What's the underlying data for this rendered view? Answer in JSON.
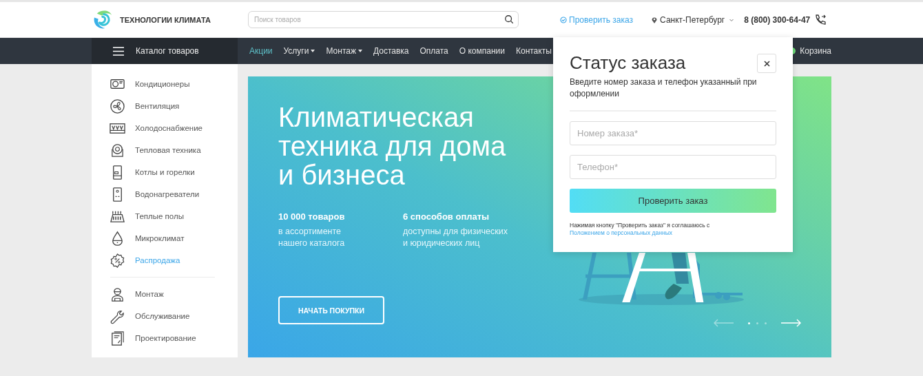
{
  "header": {
    "logo_text": "ТЕХНОЛОГИИ КЛИМАТА",
    "search": {
      "placeholder": "Поиск товаров"
    },
    "check_order": "Проверить заказ",
    "city": "Санкт-Петербург",
    "phone": "8 (800) 300-64-47"
  },
  "nav": {
    "catalog": "Каталог товаров",
    "items": [
      {
        "label": "Акции",
        "selected": true,
        "dropdown": false
      },
      {
        "label": "Услуги",
        "selected": false,
        "dropdown": true
      },
      {
        "label": "Монтаж",
        "selected": false,
        "dropdown": true
      },
      {
        "label": "Доставка",
        "selected": false,
        "dropdown": false
      },
      {
        "label": "Оплата",
        "selected": false,
        "dropdown": false
      },
      {
        "label": "О компании",
        "selected": false,
        "dropdown": false
      },
      {
        "label": "Контакты",
        "selected": false,
        "dropdown": false
      }
    ],
    "cart": "Корзина"
  },
  "sidebar": {
    "groups": [
      {
        "items": [
          {
            "label": "Кондиционеры",
            "selected": false
          },
          {
            "label": "Вентиляция",
            "selected": false
          },
          {
            "label": "Холодоснабжение",
            "selected": false
          },
          {
            "label": "Тепловая техника",
            "selected": false
          },
          {
            "label": "Котлы и горелки",
            "selected": false
          },
          {
            "label": "Водонагреватели",
            "selected": false
          },
          {
            "label": "Теплые полы",
            "selected": false
          },
          {
            "label": "Микроклимат",
            "selected": false
          },
          {
            "label": "Распродажа",
            "selected": true
          }
        ]
      },
      {
        "items": [
          {
            "label": "Монтаж",
            "selected": false
          },
          {
            "label": "Обслуживание",
            "selected": false
          },
          {
            "label": "Проектирование",
            "selected": false
          }
        ]
      }
    ]
  },
  "banner": {
    "title": "Климатическая техника для дома и бизнеса",
    "stats": [
      {
        "value": "10 000 товаров",
        "caption": "в ассортименте нашего каталога"
      },
      {
        "value": "6 способов оплаты",
        "caption": "доступны для физических и юридических лиц"
      }
    ],
    "button": "НАЧАТЬ ПОКУПКИ",
    "dots": [
      {
        "selected": true
      },
      {
        "selected": false
      },
      {
        "selected": false
      }
    ]
  },
  "order_popup": {
    "title": "Статус заказа",
    "description": "Введите номер заказа и телефон указанный при оформлении",
    "fields": [
      {
        "placeholder": "Номер заказа*"
      },
      {
        "placeholder": "Телефон*"
      }
    ],
    "submit": "Проверить заказ",
    "consent": "Нажимая кнопку \"Проверить заказ\" я соглашаюсь с",
    "consent_link": "Положением о персональных данных"
  }
}
